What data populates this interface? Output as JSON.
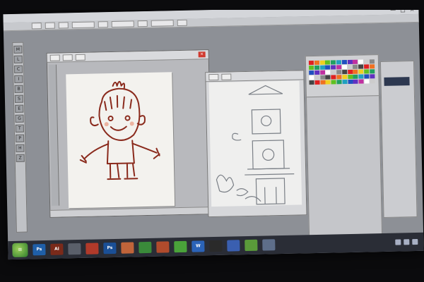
{
  "menubar": {
    "items": [
      "",
      "",
      "",
      "",
      "",
      "",
      "",
      ""
    ],
    "title": "",
    "controls": [
      "—",
      "□",
      "×"
    ]
  },
  "toolbox": {
    "tools": [
      "M",
      "L",
      "C",
      "I",
      "B",
      "S",
      "E",
      "G",
      "T",
      "P",
      "H",
      "Z"
    ]
  },
  "documents": [
    {
      "name": "doc-1",
      "status": ""
    },
    {
      "name": "doc-2",
      "status": ""
    }
  ],
  "taskbar": {
    "apps": [
      {
        "label": "Ps",
        "color": "#1f5fa8"
      },
      {
        "label": "Ai",
        "color": "#7a2a1a"
      },
      {
        "label": "",
        "color": "#5a5f6a"
      },
      {
        "label": "",
        "color": "#b03a2a"
      },
      {
        "label": "Ps",
        "color": "#1a4f96"
      },
      {
        "label": "",
        "color": "#c0643a"
      },
      {
        "label": "",
        "color": "#3a8a3a"
      },
      {
        "label": "",
        "color": "#b04b2c"
      },
      {
        "label": "",
        "color": "#4aa33a"
      },
      {
        "label": "W",
        "color": "#2b63b8"
      },
      {
        "label": "",
        "color": "#2a2a2a"
      },
      {
        "label": "",
        "color": "#3a5fb0"
      },
      {
        "label": "",
        "color": "#5a9a3a"
      },
      {
        "label": "",
        "color": "#5e6e8a"
      }
    ]
  },
  "swatches": {
    "colors": [
      "#e02020",
      "#f07020",
      "#f0d020",
      "#60c020",
      "#20a060",
      "#20a0c0",
      "#2050c0",
      "#6030c0",
      "#c030a0",
      "#ffffff",
      "#cccccc",
      "#888888",
      "#444444"
    ]
  }
}
